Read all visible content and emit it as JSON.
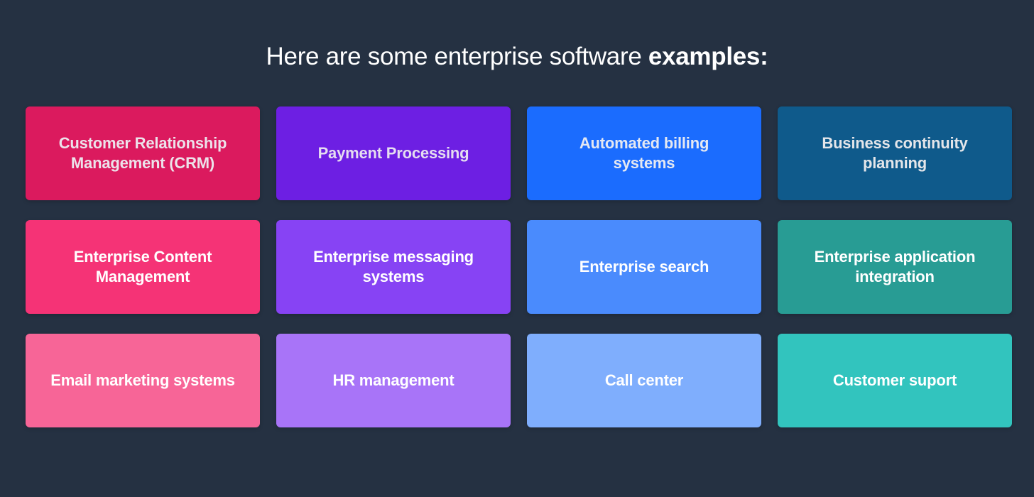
{
  "heading": {
    "prefix": "Here are some enterprise software ",
    "emphasis": "examples:"
  },
  "tiles": [
    {
      "label": "Customer Relationship Management (CRM)",
      "color": "#db1a5e",
      "text_color": "#ece2ea"
    },
    {
      "label": "Payment Processing",
      "color": "#6d1fe3",
      "text_color": "#e5ddf0"
    },
    {
      "label": "Automated billing systems",
      "color": "#1b6cfe",
      "text_color": "#e4e8f2"
    },
    {
      "label": "Business continuity planning",
      "color": "#0f5a8b",
      "text_color": "#e4e6ea"
    },
    {
      "label": "Enterprise Content Management",
      "color": "#f53376",
      "text_color": "#ffffff"
    },
    {
      "label": "Enterprise messaging systems",
      "color": "#8743f4",
      "text_color": "#ffffff"
    },
    {
      "label": "Enterprise search",
      "color": "#4a8bfd",
      "text_color": "#ffffff"
    },
    {
      "label": "Enterprise application integration",
      "color": "#289c94",
      "text_color": "#ffffff"
    },
    {
      "label": "Email marketing systems",
      "color": "#f76597",
      "text_color": "#ffffff"
    },
    {
      "label": "HR management",
      "color": "#a874f8",
      "text_color": "#ffffff"
    },
    {
      "label": "Call center",
      "color": "#7faefd",
      "text_color": "#ffffff"
    },
    {
      "label": "Customer suport",
      "color": "#32c4be",
      "text_color": "#ffffff"
    }
  ]
}
